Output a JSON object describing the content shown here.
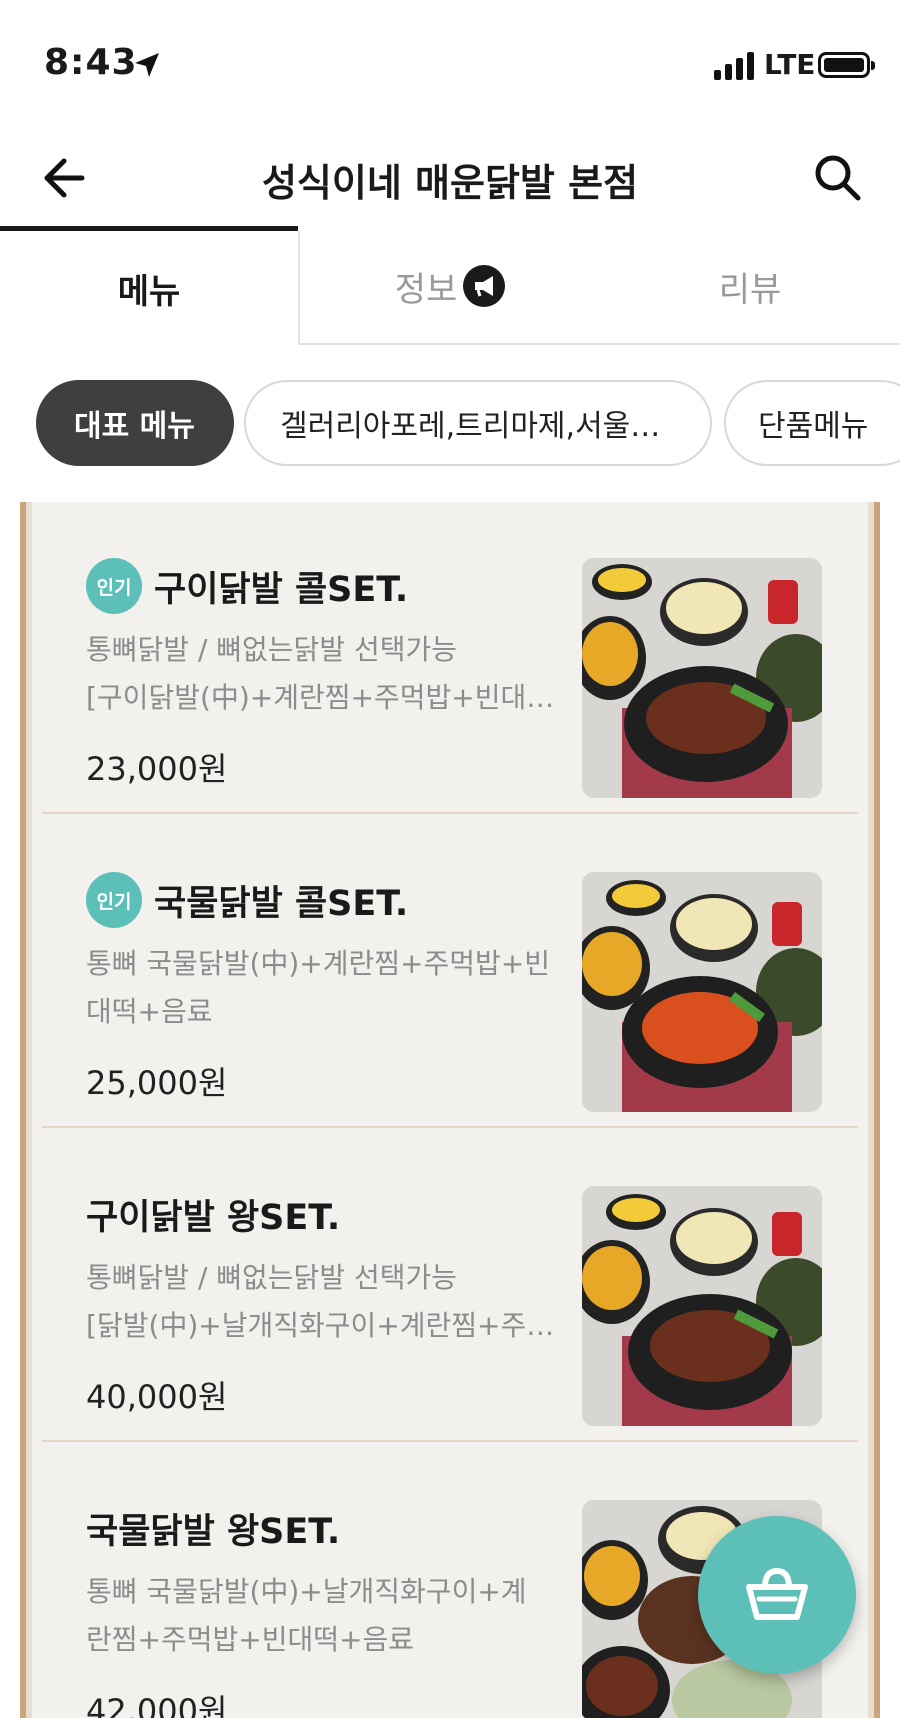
{
  "status_bar": {
    "time": "8:43",
    "network": "LTE"
  },
  "header": {
    "title": "성식이네 매운닭발 본점"
  },
  "tabs": [
    {
      "label": "메뉴",
      "active": true
    },
    {
      "label": "정보",
      "active": false
    },
    {
      "label": "리뷰",
      "active": false
    }
  ],
  "categories": [
    {
      "label": "대표 메뉴",
      "active": true
    },
    {
      "label": "겔러리아포레,트리마제,서울…",
      "active": false
    },
    {
      "label": "단품메뉴",
      "active": false
    }
  ],
  "menu": {
    "badge_label": "인기",
    "items": [
      {
        "name": "구이닭발 콜SET.",
        "popular": true,
        "desc_line1": "통뼈닭발 / 뼈없는닭발 선택가능",
        "desc_line2": "[구이닭발(中)+계란찜+주먹밥+빈대…",
        "price": "23,000원"
      },
      {
        "name": "국물닭발 콜SET.",
        "popular": true,
        "desc_line1": "통뼈 국물닭발(中)+계란찜+주먹밥+빈",
        "desc_line2": "대떡+음료",
        "price": "25,000원"
      },
      {
        "name": "구이닭발 왕SET.",
        "popular": false,
        "desc_line1": "통뼈닭발 / 뼈없는닭발 선택가능",
        "desc_line2": "[닭발(中)+날개직화구이+계란찜+주…",
        "price": "40,000원"
      },
      {
        "name": "국물닭발 왕SET.",
        "popular": false,
        "desc_line1": "통뼈 국물닭발(中)+날개직화구이+계",
        "desc_line2": "란찜+주먹밥+빈대떡+음료",
        "price": "42,000원"
      }
    ]
  },
  "colors": {
    "accent": "#5cbfb8",
    "frame": "#c9a57a",
    "chip_active": "#3f3f3f"
  },
  "icons": [
    "back-arrow-icon",
    "search-icon",
    "location-arrow-icon",
    "megaphone-icon",
    "shopping-basket-icon"
  ]
}
